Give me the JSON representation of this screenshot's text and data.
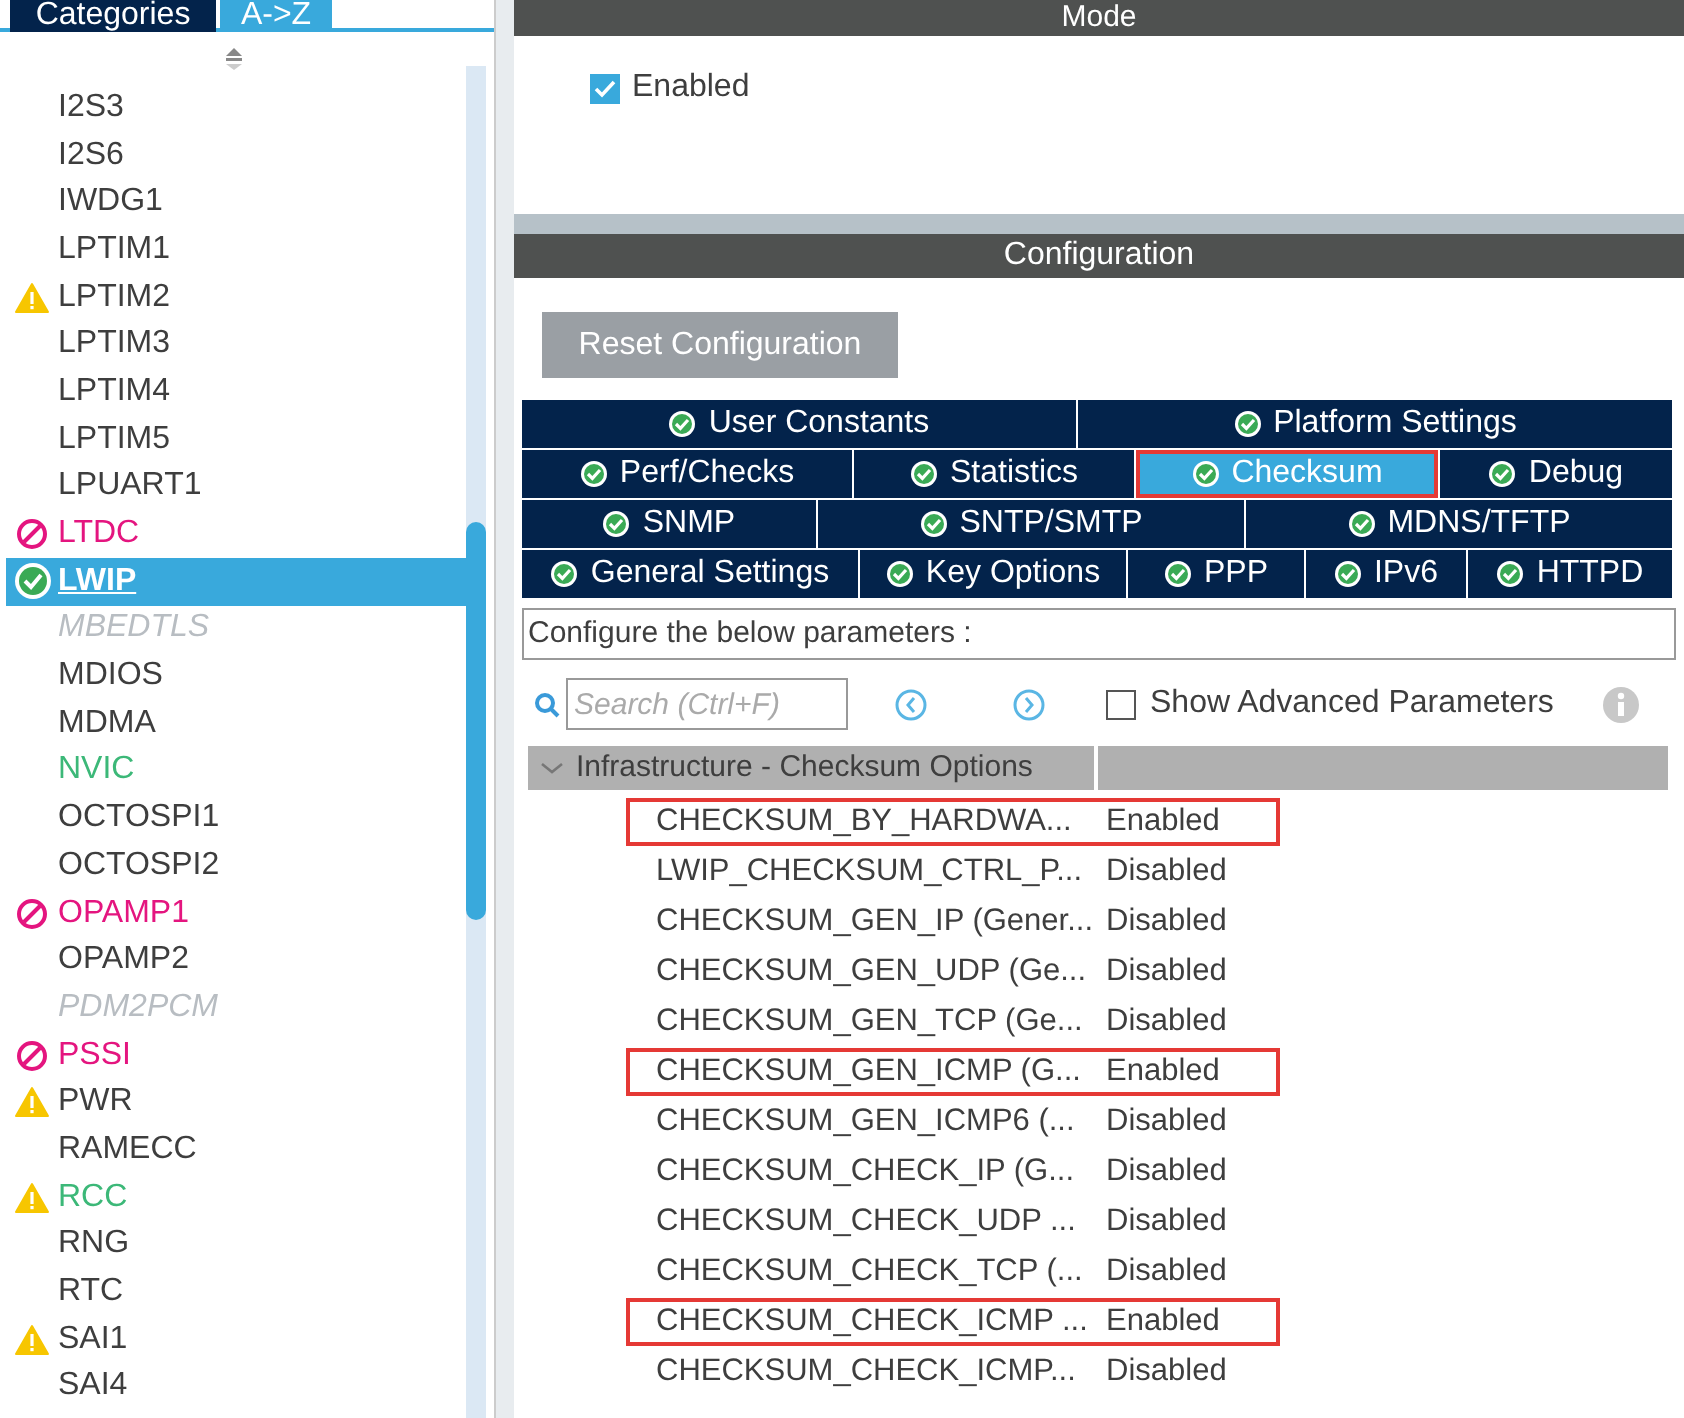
{
  "sidebar": {
    "tabs": [
      {
        "label": "Categories",
        "selected": false
      },
      {
        "label": "A->Z",
        "selected": true
      }
    ],
    "items": [
      {
        "label": "I2S3",
        "kind": "plain",
        "color": "#3e3e3e",
        "disabled": false,
        "selected": false
      },
      {
        "label": "I2S6",
        "kind": "plain",
        "color": "#3e3e3e",
        "disabled": false,
        "selected": false
      },
      {
        "label": "IWDG1",
        "kind": "plain",
        "color": "#3e3e3e",
        "disabled": false,
        "selected": false
      },
      {
        "label": "LPTIM1",
        "kind": "plain",
        "color": "#3e3e3e",
        "disabled": false,
        "selected": false
      },
      {
        "label": "LPTIM2",
        "kind": "warning",
        "color": "#3e3e3e",
        "disabled": false,
        "selected": false
      },
      {
        "label": "LPTIM3",
        "kind": "plain",
        "color": "#3e3e3e",
        "disabled": false,
        "selected": false
      },
      {
        "label": "LPTIM4",
        "kind": "plain",
        "color": "#3e3e3e",
        "disabled": false,
        "selected": false
      },
      {
        "label": "LPTIM5",
        "kind": "plain",
        "color": "#3e3e3e",
        "disabled": false,
        "selected": false
      },
      {
        "label": "LPUART1",
        "kind": "plain",
        "color": "#3e3e3e",
        "disabled": false,
        "selected": false
      },
      {
        "label": "LTDC",
        "kind": "error",
        "color": "#e4157f",
        "disabled": false,
        "selected": false
      },
      {
        "label": "LWIP",
        "kind": "ok",
        "disabled": false,
        "selected": true
      },
      {
        "label": "MBEDTLS",
        "kind": "plain",
        "color": "#b8bdc2",
        "disabled": true,
        "selected": false
      },
      {
        "label": "MDIOS",
        "kind": "plain",
        "color": "#3e3e3e",
        "disabled": false,
        "selected": false
      },
      {
        "label": "MDMA",
        "kind": "plain",
        "color": "#3e3e3e",
        "disabled": false,
        "selected": false
      },
      {
        "label": "NVIC",
        "kind": "plain",
        "color": "#3cb878",
        "disabled": false,
        "selected": false
      },
      {
        "label": "OCTOSPI1",
        "kind": "plain",
        "color": "#3e3e3e",
        "disabled": false,
        "selected": false
      },
      {
        "label": "OCTOSPI2",
        "kind": "plain",
        "color": "#3e3e3e",
        "disabled": false,
        "selected": false
      },
      {
        "label": "OPAMP1",
        "kind": "error",
        "color": "#e4157f",
        "disabled": false,
        "selected": false
      },
      {
        "label": "OPAMP2",
        "kind": "plain",
        "color": "#3e3e3e",
        "disabled": false,
        "selected": false
      },
      {
        "label": "PDM2PCM",
        "kind": "plain",
        "color": "#b8bdc2",
        "disabled": true,
        "selected": false
      },
      {
        "label": "PSSI",
        "kind": "error",
        "color": "#e4157f",
        "disabled": false,
        "selected": false
      },
      {
        "label": "PWR",
        "kind": "warning",
        "color": "#3e3e3e",
        "disabled": false,
        "selected": false
      },
      {
        "label": "RAMECC",
        "kind": "plain",
        "color": "#3e3e3e",
        "disabled": false,
        "selected": false
      },
      {
        "label": "RCC",
        "kind": "warning",
        "color": "#3cb878",
        "disabled": false,
        "selected": false
      },
      {
        "label": "RNG",
        "kind": "plain",
        "color": "#3e3e3e",
        "disabled": false,
        "selected": false
      },
      {
        "label": "RTC",
        "kind": "plain",
        "color": "#3e3e3e",
        "disabled": false,
        "selected": false
      },
      {
        "label": "SAI1",
        "kind": "warning",
        "color": "#3e3e3e",
        "disabled": false,
        "selected": false
      },
      {
        "label": "SAI4",
        "kind": "plain",
        "color": "#3e3e3e",
        "disabled": false,
        "selected": false
      }
    ]
  },
  "mode": {
    "title": "Mode",
    "enabled": {
      "label": "Enabled",
      "checked": true
    }
  },
  "configuration": {
    "title": "Configuration",
    "reset_button": "Reset Configuration",
    "tab_rows": [
      [
        {
          "label": "User Constants",
          "selected": false,
          "highlighted": false
        },
        {
          "label": "Platform Settings",
          "selected": false,
          "highlighted": false
        }
      ],
      [
        {
          "label": "Perf/Checks",
          "selected": false,
          "highlighted": false
        },
        {
          "label": "Statistics",
          "selected": false,
          "highlighted": false
        },
        {
          "label": "Checksum",
          "selected": true,
          "highlighted": true
        },
        {
          "label": "Debug",
          "selected": false,
          "highlighted": false
        }
      ],
      [
        {
          "label": "SNMP",
          "selected": false,
          "highlighted": false
        },
        {
          "label": "SNTP/SMTP",
          "selected": false,
          "highlighted": false
        },
        {
          "label": "MDNS/TFTP",
          "selected": false,
          "highlighted": false
        }
      ],
      [
        {
          "label": "General Settings",
          "selected": false,
          "highlighted": false
        },
        {
          "label": "Key Options",
          "selected": false,
          "highlighted": false
        },
        {
          "label": "PPP",
          "selected": false,
          "highlighted": false
        },
        {
          "label": "IPv6",
          "selected": false,
          "highlighted": false
        },
        {
          "label": "HTTPD",
          "selected": false,
          "highlighted": false
        }
      ]
    ],
    "description": "Configure the below parameters :",
    "search": {
      "placeholder": "Search (Ctrl+F)"
    },
    "show_advanced": {
      "label": "Show Advanced Parameters",
      "checked": false
    },
    "group": {
      "title": "Infrastructure - Checksum Options",
      "expanded": true,
      "rows": [
        {
          "name": "CHECKSUM_BY_HARDWA...",
          "value": "Enabled",
          "highlighted": true
        },
        {
          "name": "LWIP_CHECKSUM_CTRL_P...",
          "value": "Disabled",
          "highlighted": false
        },
        {
          "name": "CHECKSUM_GEN_IP (Gener...",
          "value": "Disabled",
          "highlighted": false
        },
        {
          "name": "CHECKSUM_GEN_UDP (Ge...",
          "value": "Disabled",
          "highlighted": false
        },
        {
          "name": "CHECKSUM_GEN_TCP (Ge...",
          "value": "Disabled",
          "highlighted": false
        },
        {
          "name": "CHECKSUM_GEN_ICMP (G...",
          "value": "Enabled",
          "highlighted": true
        },
        {
          "name": "CHECKSUM_GEN_ICMP6 (...",
          "value": "Disabled",
          "highlighted": false
        },
        {
          "name": "CHECKSUM_CHECK_IP (G...",
          "value": "Disabled",
          "highlighted": false
        },
        {
          "name": "CHECKSUM_CHECK_UDP ...",
          "value": "Disabled",
          "highlighted": false
        },
        {
          "name": "CHECKSUM_CHECK_TCP (...",
          "value": "Disabled",
          "highlighted": false
        },
        {
          "name": "CHECKSUM_CHECK_ICMP ...",
          "value": "Enabled",
          "highlighted": true
        },
        {
          "name": "CHECKSUM_CHECK_ICMP...",
          "value": "Disabled",
          "highlighted": false
        }
      ]
    }
  }
}
